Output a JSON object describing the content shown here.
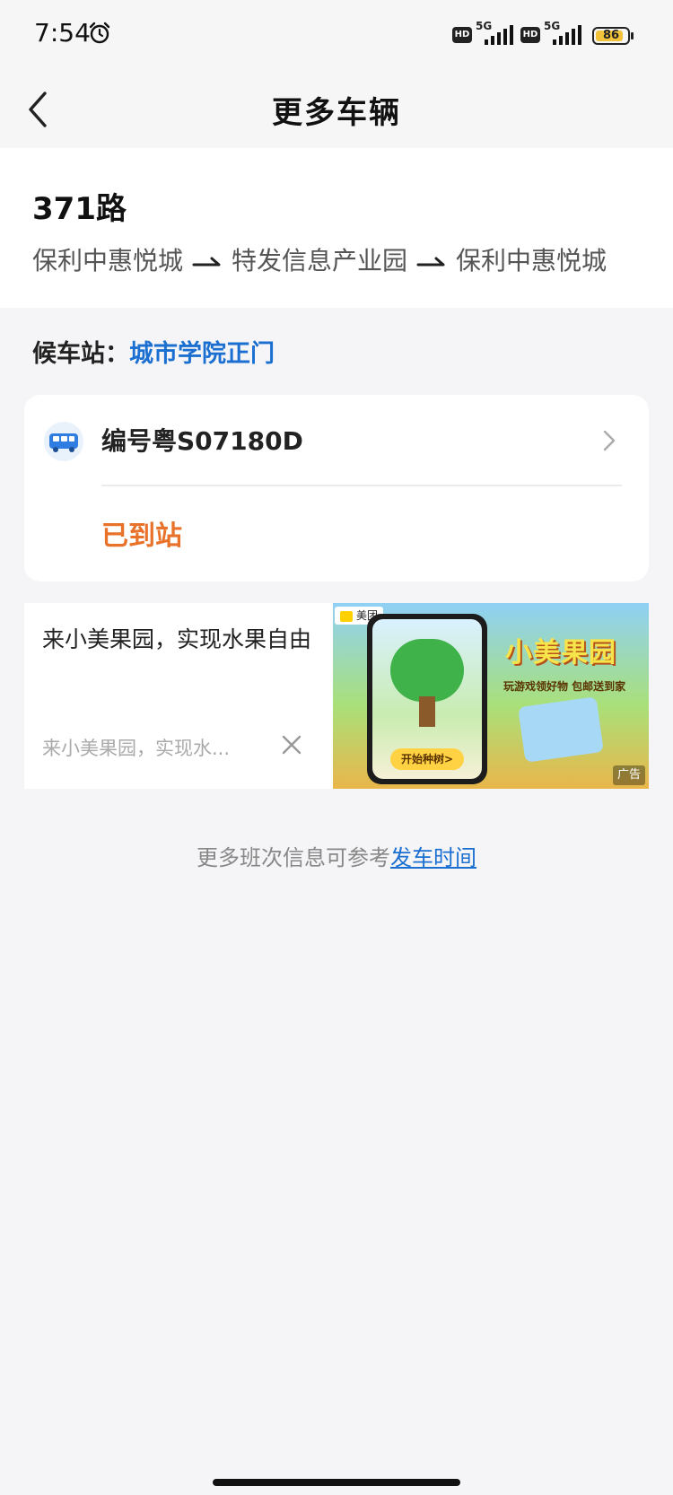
{
  "status_bar": {
    "time": "7:54",
    "network_1": "5G",
    "network_2": "5G",
    "hd": "HD",
    "battery": "86"
  },
  "header": {
    "title": "更多车辆"
  },
  "route": {
    "name": "371路",
    "stops": [
      "保利中惠悦城",
      "特发信息产业园",
      "保利中惠悦城"
    ]
  },
  "stop": {
    "label": "候车站：",
    "name": "城市学院正门"
  },
  "vehicle": {
    "plate": "编号粤S07180D",
    "status": "已到站",
    "status_color": "#e8722a"
  },
  "ad": {
    "title": "来小美果园，实现水果自由",
    "description": "来小美果园，实现水...",
    "image": {
      "brand": "美团",
      "headline": "小美果园",
      "slogan": "玩游戏领好物 包邮送到家",
      "button": "开始种树>",
      "tag": "广告"
    }
  },
  "footer": {
    "text": "更多班次信息可参考",
    "link": "发车时间"
  },
  "colors": {
    "accent": "#1a6fd0",
    "background": "#f5f5f7"
  }
}
